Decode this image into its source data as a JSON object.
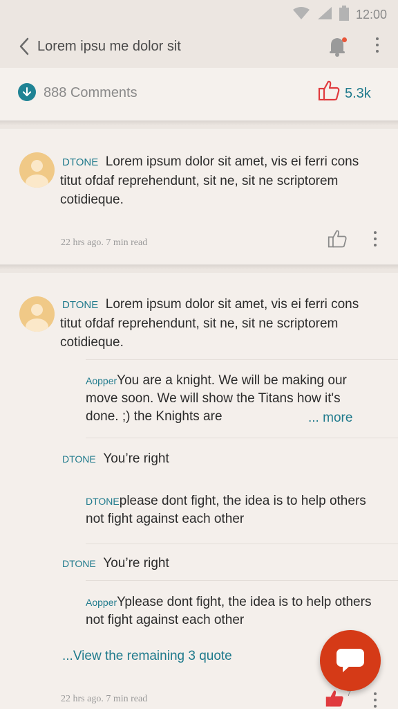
{
  "status": {
    "time": "12:00"
  },
  "header": {
    "title": "Lorem ipsu me dolor sit"
  },
  "summary": {
    "comments": "888 Comments",
    "likes": "5.3k"
  },
  "comments": [
    {
      "user": "DTONE",
      "text": "Lorem ipsum dolor sit amet, vis ei ferri cons titut ofdaf reprehendunt, sit ne, sit ne scriptorem cotidieque.",
      "meta": "22 hrs ago. 7 min read"
    },
    {
      "user": "DTONE",
      "text": "Lorem ipsum dolor sit amet, vis ei ferri cons titut ofdaf reprehendunt, sit ne, sit ne scriptorem cotidieque.",
      "meta": "22 hrs ago. 7 min read",
      "like_count": "7",
      "replies": [
        {
          "user": "Aopper",
          "text": "You are a knight. We will be making our move soon. We will show the Titans how it's done. ;) the Knights are",
          "more": "... more"
        },
        {
          "user": "DTONE",
          "text": "You’re right"
        },
        {
          "user": "DTONE",
          "text": "please dont fight, the idea is to help others not fight against each other"
        },
        {
          "user": "DTONE",
          "text": "You’re right"
        },
        {
          "user": "Aopper",
          "text": "Yplease dont fight, the idea is to help others not fight against each other"
        }
      ],
      "view_remaining": "...View the remaining 3 quote"
    }
  ],
  "colors": {
    "accent": "#1f7a8c",
    "fab": "#d53a17",
    "like": "#e03a3e"
  }
}
